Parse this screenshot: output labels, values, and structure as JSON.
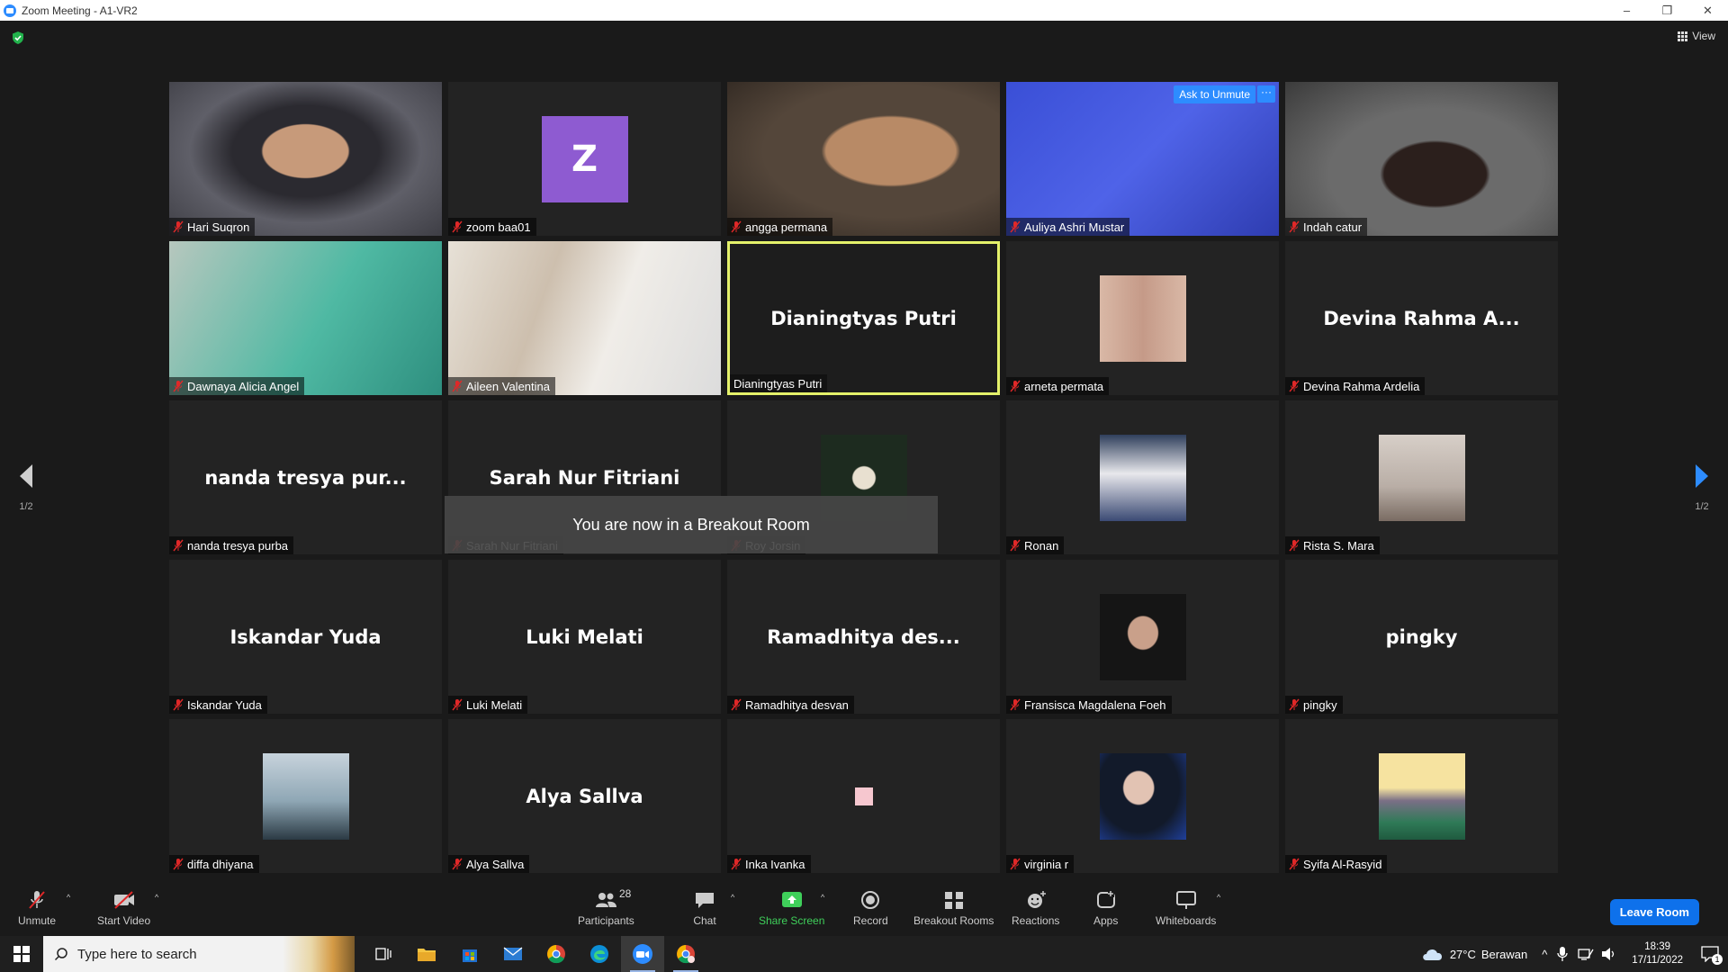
{
  "window": {
    "title": "Zoom Meeting - A1-VR2",
    "controls": [
      "–",
      "❐",
      "✕"
    ]
  },
  "header": {
    "view_label": "View"
  },
  "colors": {
    "accent": "#2d8cff",
    "active_speaker_border": "#e4f16a",
    "muted_icon": "#e02828",
    "share_green": "#3fcf5a",
    "leave_button": "#0e71eb"
  },
  "tiles": [
    {
      "label": "Hari Suqron",
      "kind": "video"
    },
    {
      "label": "zoom baa01",
      "kind": "avatar",
      "avatar_letter": "Z"
    },
    {
      "label": "angga permana",
      "kind": "video"
    },
    {
      "label": "Auliya Ashri Mustar",
      "kind": "video",
      "ask_unmute": "Ask to Unmute",
      "more": "···"
    },
    {
      "label": "Indah catur",
      "kind": "video"
    },
    {
      "label": "Dawnaya Alicia Angel",
      "kind": "video"
    },
    {
      "label": "Aileen Valentina",
      "kind": "video"
    },
    {
      "label": "Dianingtyas Putri",
      "big_name": "Dianingtyas Putri",
      "kind": "name",
      "active": true
    },
    {
      "label": "arneta permata",
      "kind": "photo"
    },
    {
      "label": "Devina Rahma Ardelia",
      "big_name": "Devina Rahma A...",
      "kind": "name"
    },
    {
      "label": "nanda tresya purba",
      "big_name": "nanda tresya pur...",
      "kind": "name"
    },
    {
      "label": "Sarah Nur Fitriani",
      "big_name": "Sarah Nur Fitriani",
      "kind": "name"
    },
    {
      "label": "Roy Jorsin",
      "kind": "photo"
    },
    {
      "label": "Ronan",
      "kind": "photo"
    },
    {
      "label": "Rista S. Mara",
      "kind": "photo"
    },
    {
      "label": "Iskandar Yuda",
      "big_name": "Iskandar Yuda",
      "kind": "name"
    },
    {
      "label": "Luki Melati",
      "big_name": "Luki Melati",
      "kind": "name"
    },
    {
      "label": "Ramadhitya desvan",
      "big_name": "Ramadhitya des...",
      "kind": "name"
    },
    {
      "label": "Fransisca Magdalena Foeh",
      "kind": "photo"
    },
    {
      "label": "pingky",
      "big_name": "pingky",
      "kind": "name"
    },
    {
      "label": "diffa dhiyana",
      "kind": "photo"
    },
    {
      "label": "Alya Sallva",
      "big_name": "Alya Sallva",
      "kind": "name"
    },
    {
      "label": "Inka Ivanka",
      "kind": "square"
    },
    {
      "label": "virginia r",
      "kind": "photo"
    },
    {
      "label": "Syifa Al-Rasyid",
      "kind": "photo"
    }
  ],
  "toast": "You are now in a Breakout Room",
  "nav": {
    "left_page": "1/2",
    "right_page": "1/2"
  },
  "toolbar": {
    "unmute": "Unmute",
    "start_video": "Start Video",
    "participants": "Participants",
    "participants_count": "28",
    "chat": "Chat",
    "share_screen": "Share Screen",
    "record": "Record",
    "breakout_rooms": "Breakout Rooms",
    "reactions": "Reactions",
    "apps": "Apps",
    "whiteboards": "Whiteboards",
    "leave_room": "Leave Room"
  },
  "taskbar": {
    "search_placeholder": "Type here to search",
    "temperature": "27°C",
    "weather": "Berawan",
    "time": "18:39",
    "date": "17/11/2022",
    "notification_count": "1"
  }
}
